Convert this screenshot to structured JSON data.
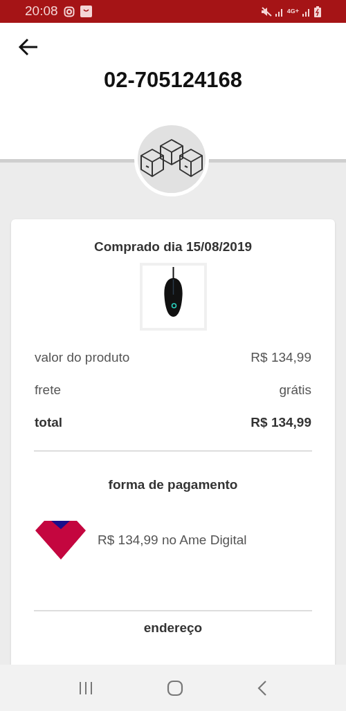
{
  "status_bar": {
    "time": "20:08",
    "network": "4G+"
  },
  "header": {
    "title": "02-705124168"
  },
  "order": {
    "purchase_date": "Comprado dia 15/08/2019",
    "summary": [
      {
        "label": "valor do produto",
        "value": "R$ 134,99",
        "kind": "normal"
      },
      {
        "label": "frete",
        "value": "grátis",
        "kind": "normal"
      },
      {
        "label": "total",
        "value": "R$ 134,99",
        "kind": "total"
      }
    ],
    "payment": {
      "heading": "forma de pagamento",
      "text": "R$ 134,99 no Ame Digital"
    },
    "address": {
      "heading": "endereço"
    }
  }
}
